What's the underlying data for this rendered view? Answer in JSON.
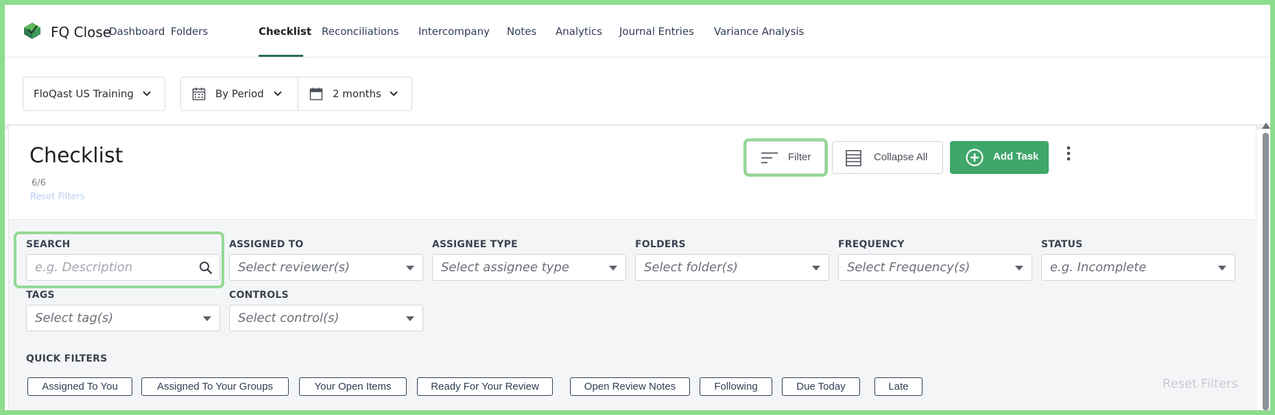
{
  "app": {
    "title": "FQ Close",
    "logo_icon": "floqast-logo-icon"
  },
  "nav": {
    "items": [
      {
        "label": "Dashboard",
        "active": false
      },
      {
        "label": "Folders",
        "active": false
      },
      {
        "label": "Checklist",
        "active": true
      },
      {
        "label": "Reconciliations",
        "active": false
      },
      {
        "label": "Intercompany",
        "active": false
      },
      {
        "label": "Notes",
        "active": false
      },
      {
        "label": "Analytics",
        "active": false
      },
      {
        "label": "Journal Entries",
        "active": false
      },
      {
        "label": "Variance Analysis",
        "active": false
      }
    ]
  },
  "toolbar": {
    "entity": "FloQast US Training",
    "view_mode": "By Period",
    "range": "2 months"
  },
  "checklist": {
    "title": "Checklist",
    "count": "6/6",
    "reset_filters": "Reset Filters",
    "filter_button": "Filter",
    "collapse_button": "Collapse All",
    "add_task_button": "Add Task"
  },
  "filters": {
    "search": {
      "label": "SEARCH",
      "placeholder": "e.g. Description"
    },
    "assigned_to": {
      "label": "ASSIGNED TO",
      "placeholder": "Select reviewer(s)"
    },
    "assignee_type": {
      "label": "ASSIGNEE TYPE",
      "placeholder": "Select assignee type"
    },
    "folders": {
      "label": "FOLDERS",
      "placeholder": "Select folder(s)"
    },
    "frequency": {
      "label": "FREQUENCY",
      "placeholder": "Select Frequency(s)"
    },
    "status": {
      "label": "STATUS",
      "placeholder": "e.g. Incomplete"
    },
    "tags": {
      "label": "TAGS",
      "placeholder": "Select tag(s)"
    },
    "controls": {
      "label": "CONTROLS",
      "placeholder": "Select control(s)"
    }
  },
  "quick_filters": {
    "label": "QUICK FILTERS",
    "chips": [
      "Assigned To You",
      "Assigned To Your Groups",
      "Your Open Items",
      "Ready For Your Review",
      "Open Review Notes",
      "Following",
      "Due Today",
      "Late"
    ],
    "reset": "Reset Filters"
  },
  "colors": {
    "accent_green": "#3fa76a",
    "highlight_green": "#93d994",
    "nav_underline": "#2c6e53"
  }
}
